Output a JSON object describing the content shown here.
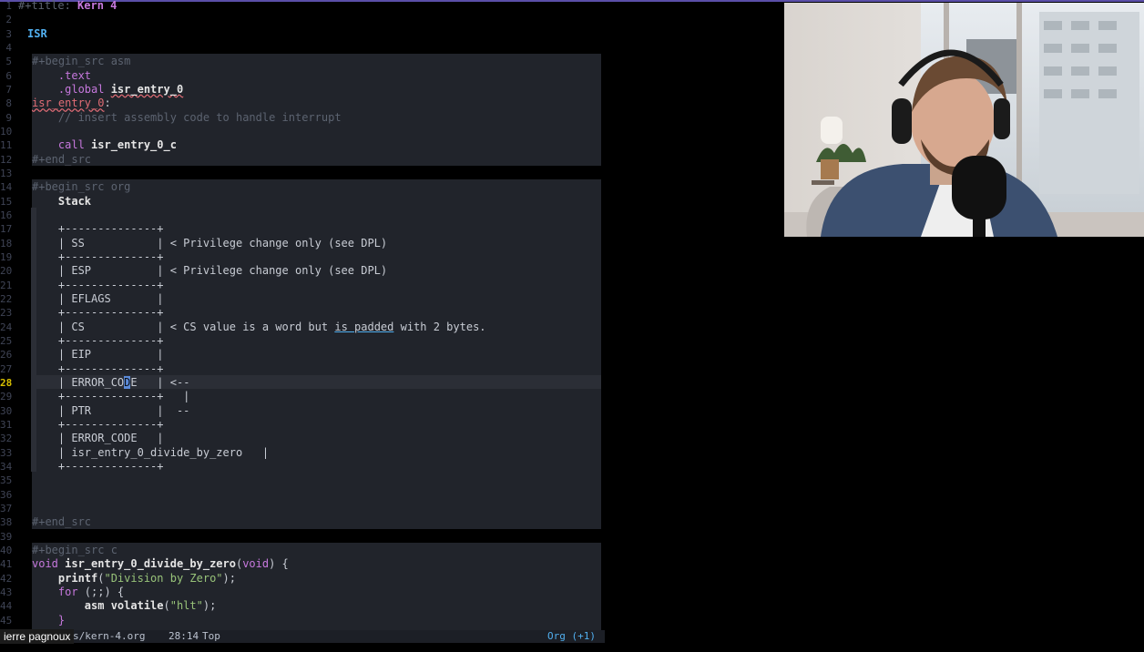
{
  "editor": {
    "lines": [
      {
        "n": "1",
        "parts": [
          {
            "t": "#+title: ",
            "c": "hd"
          },
          {
            "t": "Kern 4",
            "c": "title"
          }
        ]
      },
      {
        "n": "2",
        "parts": []
      },
      {
        "n": "3",
        "parts": [
          {
            "t": "ISR",
            "c": "h1"
          }
        ],
        "indent": 10
      },
      {
        "n": "4",
        "parts": []
      },
      {
        "n": "5",
        "parts": [
          {
            "t": "#+begin_src asm",
            "c": "hd"
          }
        ],
        "indent": 15
      },
      {
        "n": "6",
        "parts": [
          {
            "t": "    .text",
            "c": "kw"
          }
        ],
        "indent": 15
      },
      {
        "n": "7",
        "parts": [
          {
            "t": "    .global ",
            "c": "kw"
          },
          {
            "t": "isr_entry_0",
            "c": "fn err"
          }
        ],
        "indent": 15
      },
      {
        "n": "8",
        "parts": [
          {
            "t": "isr_entry_0",
            "c": "lbl err"
          },
          {
            "t": ":",
            "c": ""
          }
        ],
        "indent": 15
      },
      {
        "n": "9",
        "parts": [
          {
            "t": "    // insert assembly code to handle interrupt",
            "c": "cm"
          }
        ],
        "indent": 15
      },
      {
        "n": "10",
        "parts": []
      },
      {
        "n": "11",
        "parts": [
          {
            "t": "    call ",
            "c": "kw"
          },
          {
            "t": "isr_entry_0_c",
            "c": "fn"
          }
        ],
        "indent": 15
      },
      {
        "n": "12",
        "parts": [
          {
            "t": "#+end_src",
            "c": "hd"
          }
        ],
        "indent": 15
      },
      {
        "n": "13",
        "parts": []
      },
      {
        "n": "14",
        "parts": [
          {
            "t": "#+begin_src org",
            "c": "hd"
          }
        ],
        "indent": 15
      },
      {
        "n": "15",
        "parts": [
          {
            "t": "    Stack",
            "c": "fn"
          }
        ],
        "indent": 15
      },
      {
        "n": "16",
        "parts": []
      },
      {
        "n": "17",
        "parts": [
          {
            "t": "    +--------------+",
            "c": ""
          }
        ],
        "indent": 15
      },
      {
        "n": "18",
        "parts": [
          {
            "t": "    | SS           | < Privilege change only (see DPL)",
            "c": ""
          }
        ],
        "indent": 15
      },
      {
        "n": "19",
        "parts": [
          {
            "t": "    +--------------+",
            "c": ""
          }
        ],
        "indent": 15
      },
      {
        "n": "20",
        "parts": [
          {
            "t": "    | ESP          | < Privilege change only (see DPL)",
            "c": ""
          }
        ],
        "indent": 15
      },
      {
        "n": "21",
        "parts": [
          {
            "t": "    +--------------+",
            "c": ""
          }
        ],
        "indent": 15
      },
      {
        "n": "22",
        "parts": [
          {
            "t": "    | EFLAGS       |",
            "c": ""
          }
        ],
        "indent": 15
      },
      {
        "n": "23",
        "parts": [
          {
            "t": "    +--------------+",
            "c": ""
          }
        ],
        "indent": 15
      },
      {
        "n": "24",
        "parts": [
          {
            "t": "    | CS           | < CS value is a word but ",
            "c": ""
          },
          {
            "t": "is padded",
            "c": "pad"
          },
          {
            "t": " with 2 bytes.",
            "c": ""
          }
        ],
        "indent": 15
      },
      {
        "n": "25",
        "parts": [
          {
            "t": "    +--------------+",
            "c": ""
          }
        ],
        "indent": 15
      },
      {
        "n": "26",
        "parts": [
          {
            "t": "    | EIP          |",
            "c": ""
          }
        ],
        "indent": 15
      },
      {
        "n": "27",
        "parts": [
          {
            "t": "    +--------------+",
            "c": ""
          }
        ],
        "indent": 15
      },
      {
        "n": "28",
        "parts": [
          {
            "t": "    | ERROR_CO",
            "c": ""
          },
          {
            "t": "D",
            "c": "cursor"
          },
          {
            "t": "E   | <--",
            "c": ""
          }
        ],
        "indent": 15,
        "current": true
      },
      {
        "n": "29",
        "parts": [
          {
            "t": "    +--------------+   |",
            "c": ""
          }
        ],
        "indent": 15
      },
      {
        "n": "30",
        "parts": [
          {
            "t": "    | PTR          |  --",
            "c": ""
          }
        ],
        "indent": 15
      },
      {
        "n": "31",
        "parts": [
          {
            "t": "    +--------------+",
            "c": ""
          }
        ],
        "indent": 15
      },
      {
        "n": "32",
        "parts": [
          {
            "t": "    | ERROR_CODE   |",
            "c": ""
          }
        ],
        "indent": 15
      },
      {
        "n": "33",
        "parts": [
          {
            "t": "    | isr_entry_0_divide_by_zero   |",
            "c": ""
          }
        ],
        "indent": 15
      },
      {
        "n": "34",
        "parts": [
          {
            "t": "    +--------------+",
            "c": ""
          }
        ],
        "indent": 15
      },
      {
        "n": "35",
        "parts": []
      },
      {
        "n": "36",
        "parts": []
      },
      {
        "n": "37",
        "parts": []
      },
      {
        "n": "38",
        "parts": [
          {
            "t": "#+end_src",
            "c": "hd"
          }
        ],
        "indent": 15
      },
      {
        "n": "39",
        "parts": []
      },
      {
        "n": "40",
        "parts": [
          {
            "t": "#+begin_src c",
            "c": "hd"
          }
        ],
        "indent": 15
      },
      {
        "n": "41",
        "parts": [
          {
            "t": "void ",
            "c": "kw"
          },
          {
            "t": "isr_entry_0_divide_by_zero",
            "c": "fn"
          },
          {
            "t": "(",
            "c": ""
          },
          {
            "t": "void",
            "c": "kw"
          },
          {
            "t": ") {",
            "c": ""
          }
        ],
        "indent": 15
      },
      {
        "n": "42",
        "parts": [
          {
            "t": "    printf",
            "c": "fn"
          },
          {
            "t": "(",
            "c": ""
          },
          {
            "t": "\"Division by Zero\"",
            "c": "str"
          },
          {
            "t": ");",
            "c": ""
          }
        ],
        "indent": 15
      },
      {
        "n": "43",
        "parts": [
          {
            "t": "    for",
            "c": "kw"
          },
          {
            "t": " (;;) {",
            "c": ""
          }
        ],
        "indent": 15
      },
      {
        "n": "44",
        "parts": [
          {
            "t": "        asm volatile",
            "c": "fn"
          },
          {
            "t": "(",
            "c": ""
          },
          {
            "t": "\"hlt\"",
            "c": "str"
          },
          {
            "t": ");",
            "c": ""
          }
        ],
        "indent": 15
      },
      {
        "n": "45",
        "parts": [
          {
            "t": "    }",
            "c": "kw"
          }
        ],
        "indent": 15
      }
    ]
  },
  "modeline": {
    "file": "s/kern-4.org",
    "position": "28:14",
    "percent": "Top",
    "mode": "Org (+1)"
  },
  "zoom": {
    "participant_name": "ierre pagnoux"
  },
  "colors": {
    "background": "#000000",
    "block_bg": "#21242b",
    "accent": "#51afef"
  }
}
